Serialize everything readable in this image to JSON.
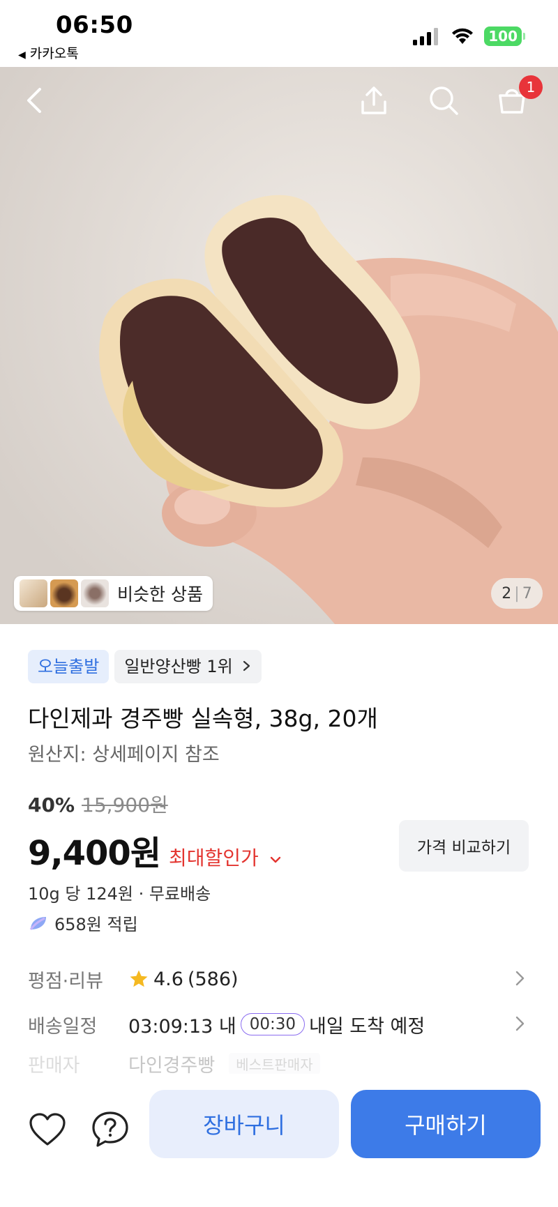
{
  "status_bar": {
    "time": "06:50",
    "back_app": "카카오톡",
    "battery": "100",
    "icons": [
      "cellular-signal-icon",
      "wifi-icon",
      "battery-icon"
    ]
  },
  "hero": {
    "icons": [
      "back-arrow-icon",
      "share-icon",
      "search-icon",
      "cart-icon"
    ],
    "cart_badge": "1",
    "similar_label": "비슷한 상품",
    "pager_current": "2",
    "pager_separator": "|",
    "pager_total": "7"
  },
  "product": {
    "tag_today": "오늘출발",
    "tag_rank": "일반양산빵 1위",
    "title": "다인제과 경주빵 실속형, 38g, 20개",
    "origin": "원산지: 상세페이지 참조",
    "discount_pct": "40%",
    "original_price": "15,900원",
    "price": "9,400원",
    "max_discount": "최대할인가",
    "compare_label": "가격 비교하기",
    "unit_price": "10g 당 124원 · 무료배송",
    "points": "658원 적립"
  },
  "info_rows": {
    "rating_label": "평점·리뷰",
    "rating_value": "4.6",
    "review_count": "(586)",
    "delivery_label": "배송일정",
    "delivery_countdown": "03:09:13 내",
    "delivery_timer": "00:30",
    "delivery_eta": "내일 도착 예정",
    "seller_label": "판매자",
    "seller_name": "다인경주빵",
    "seller_badge": "베스트판매자"
  },
  "bottom_bar": {
    "icons": [
      "heart-icon",
      "help-icon"
    ],
    "cart_label": "장바구니",
    "buy_label": "구매하기"
  },
  "colors": {
    "accent_blue": "#3d7be8",
    "discount_red": "#e3342f",
    "badge_red": "#e8343a",
    "star": "#f5b921"
  }
}
